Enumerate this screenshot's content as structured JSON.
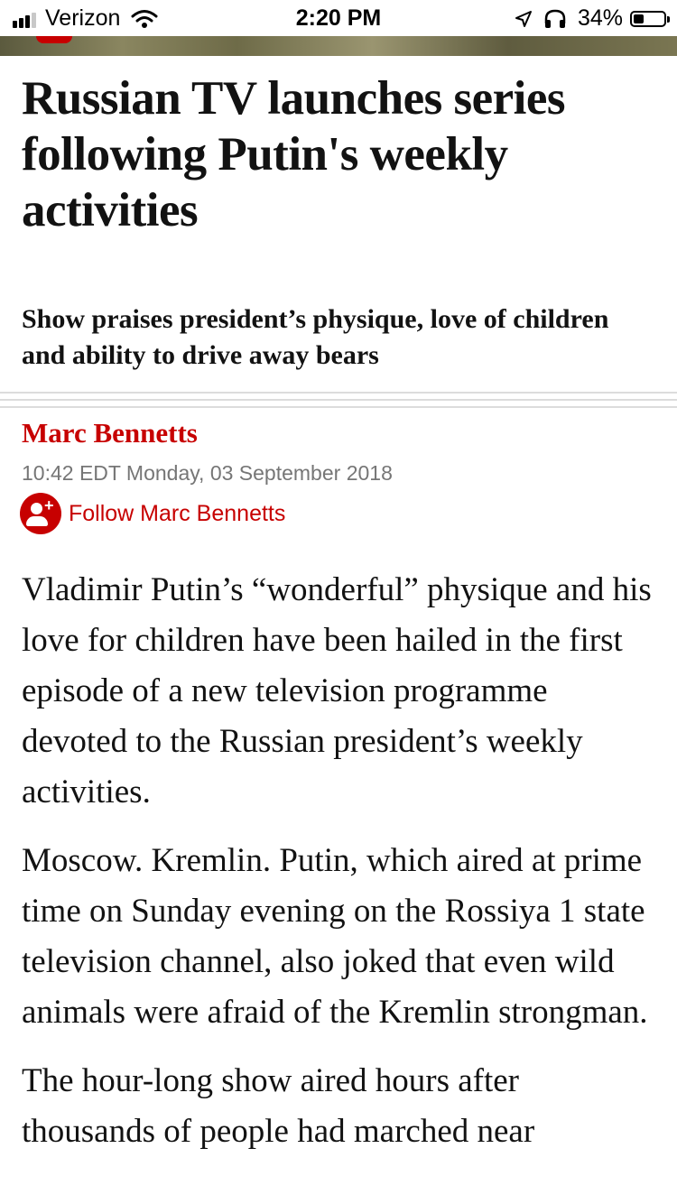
{
  "status_bar": {
    "carrier": "Verizon",
    "time": "2:20 PM",
    "battery": "34%",
    "battery_level": 0.34,
    "icons": [
      "signal-bars-icon",
      "wifi-icon",
      "location-arrow-icon",
      "headphones-icon",
      "battery-icon"
    ]
  },
  "article": {
    "headline": "Russian TV launches series following Putin's weekly activities",
    "standfirst": "Show praises president’s physique, love of children and ability to drive away bears",
    "author": "Marc Bennetts",
    "dateline": "10:42 EDT Monday, 03 September 2018",
    "follow_label": "Follow Marc Bennetts",
    "paragraphs": [
      "Vladimir Putin’s “wonderful” physique and his love for children have been hailed in the first episode of a new television programme devoted to the Russian president’s weekly activities.",
      "Moscow. Kremlin. Putin, which aired at prime time on Sunday evening on the Rossiya 1 state television channel, also joked that even wild animals were afraid of the Kremlin strongman.",
      "The hour-long show aired hours after thousands of people had marched near"
    ]
  },
  "colors": {
    "accent": "#c70000",
    "text": "#121212",
    "meta": "#767676"
  }
}
